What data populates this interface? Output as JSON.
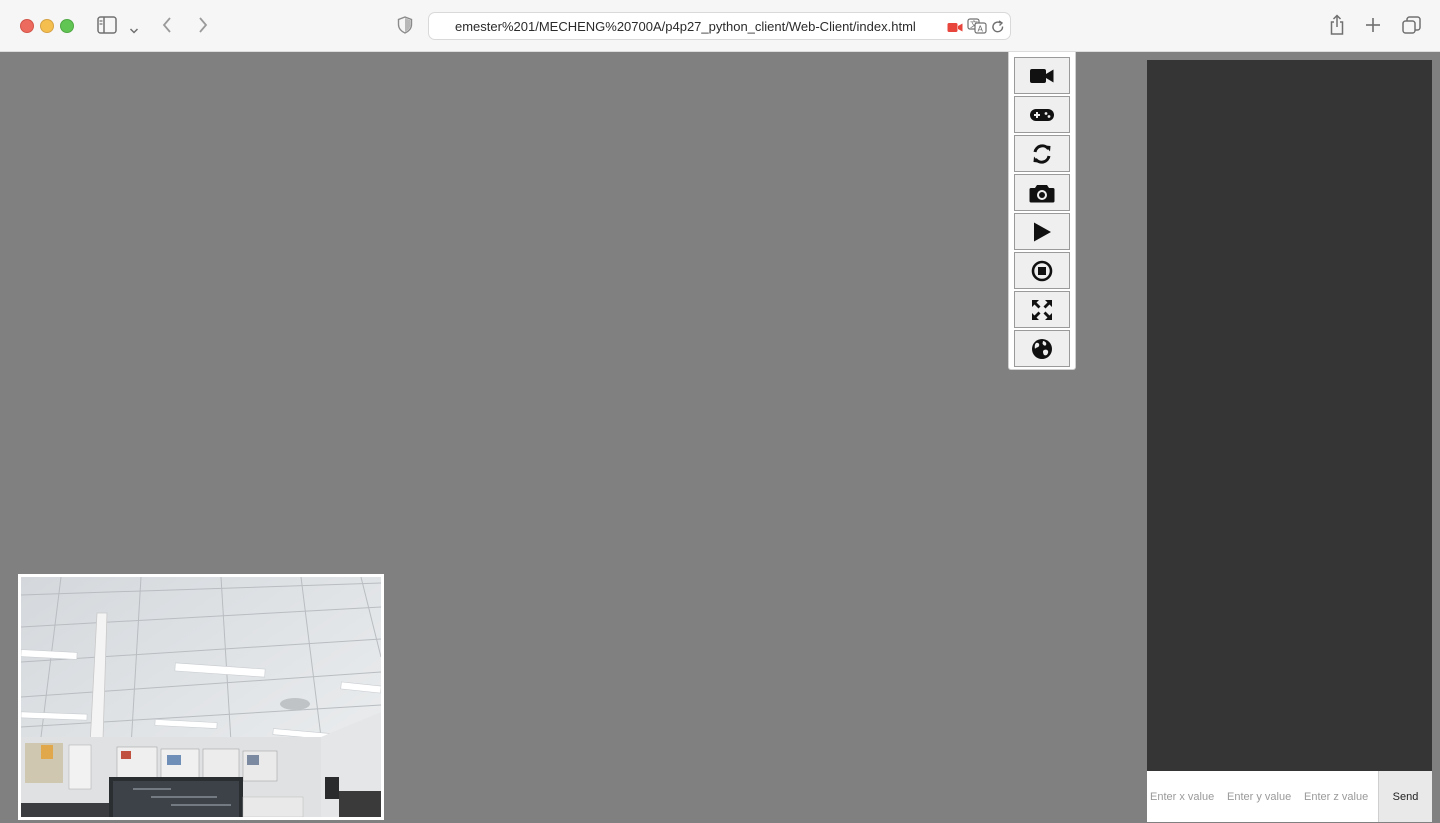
{
  "browser": {
    "url": "emester%201/MECHENG%20700A/p4p27_python_client/Web-Client/index.html",
    "icons": [
      "sidebar-icon",
      "chevron-down-icon",
      "back-icon",
      "forward-icon",
      "shield-icon",
      "camera-recording-icon",
      "translate-icon",
      "reload-icon",
      "share-icon",
      "new-tab-icon",
      "tab-overview-icon"
    ]
  },
  "toolbar": {
    "buttons": [
      {
        "name": "video-camera-icon"
      },
      {
        "name": "gamepad-icon"
      },
      {
        "name": "refresh-icon"
      },
      {
        "name": "camera-icon"
      },
      {
        "name": "play-icon"
      },
      {
        "name": "stop-icon"
      },
      {
        "name": "fullscreen-icon"
      },
      {
        "name": "globe-icon"
      }
    ]
  },
  "coords": {
    "x_placeholder": "Enter x value",
    "y_placeholder": "Enter y value",
    "z_placeholder": "Enter z value",
    "send_label": "Send"
  },
  "colors": {
    "stage_bg": "#808080",
    "panel_bg": "#353535",
    "record_red": "#e8453c"
  }
}
